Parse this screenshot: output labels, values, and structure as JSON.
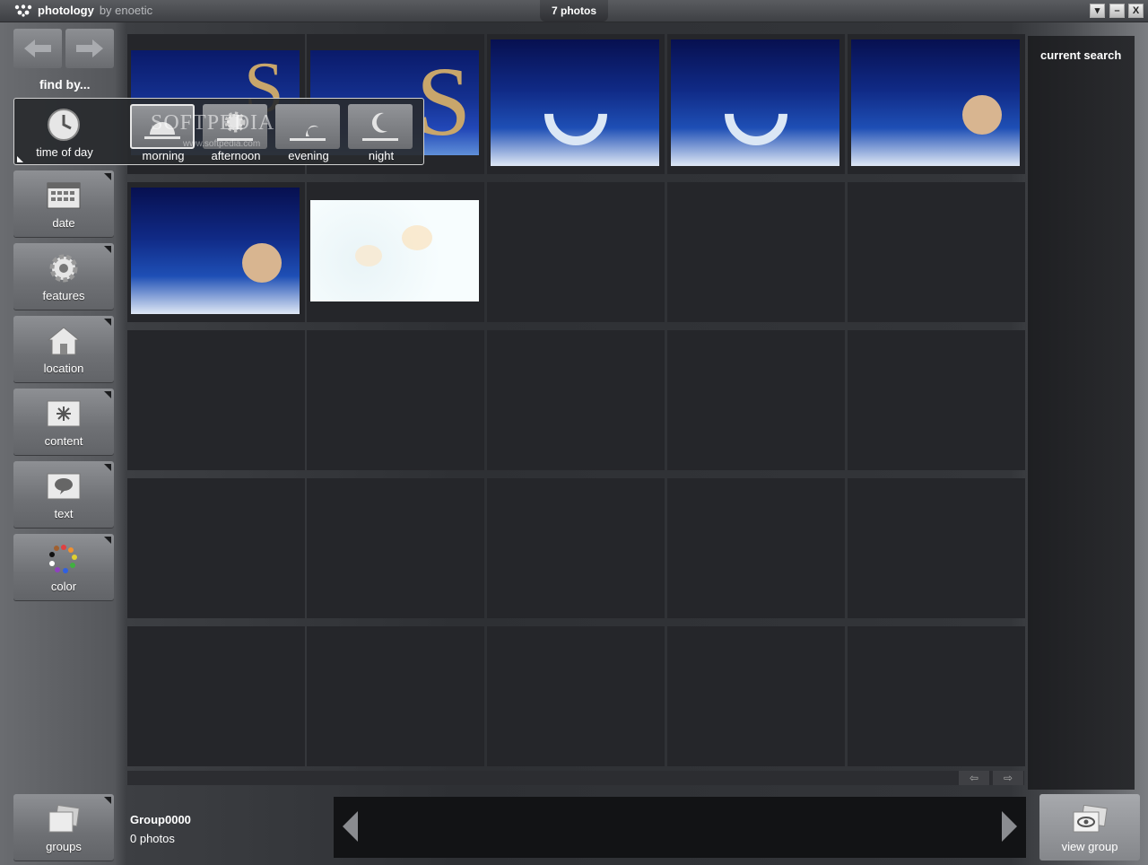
{
  "titlebar": {
    "brand": "photology",
    "by": "by enoetic",
    "photo_count": "7 photos",
    "buttons": [
      "▾",
      "–",
      "X"
    ]
  },
  "sidebar": {
    "find_by": "find by...",
    "tools": [
      {
        "id": "date",
        "label": "date",
        "icon": "calendar-icon"
      },
      {
        "id": "features",
        "label": "features",
        "icon": "gear-icon"
      },
      {
        "id": "location",
        "label": "location",
        "icon": "house-icon"
      },
      {
        "id": "content",
        "label": "content",
        "icon": "content-icon"
      },
      {
        "id": "text",
        "label": "text",
        "icon": "speech-bubble-icon"
      },
      {
        "id": "color",
        "label": "color",
        "icon": "color-wheel-icon"
      }
    ]
  },
  "time_of_day": {
    "label": "time of day",
    "options": [
      {
        "label": "morning",
        "selected": true,
        "icon": "sunrise-icon"
      },
      {
        "label": "afternoon",
        "selected": false,
        "icon": "sun-icon"
      },
      {
        "label": "evening",
        "selected": false,
        "icon": "moonrise-icon"
      },
      {
        "label": "night",
        "selected": false,
        "icon": "moon-icon"
      }
    ],
    "watermark": "SOFTPEDIA",
    "watermark_url": "www.softpedia.com"
  },
  "right_panel": {
    "title": "current search"
  },
  "bottom": {
    "groups_label": "groups",
    "group_name": "Group0000",
    "group_count": "0 photos",
    "view_group_label": "view group"
  },
  "colors": {
    "accent_white": "#ffffff",
    "cell_bg": "#25262a",
    "filmstrip_bg": "#121315"
  }
}
